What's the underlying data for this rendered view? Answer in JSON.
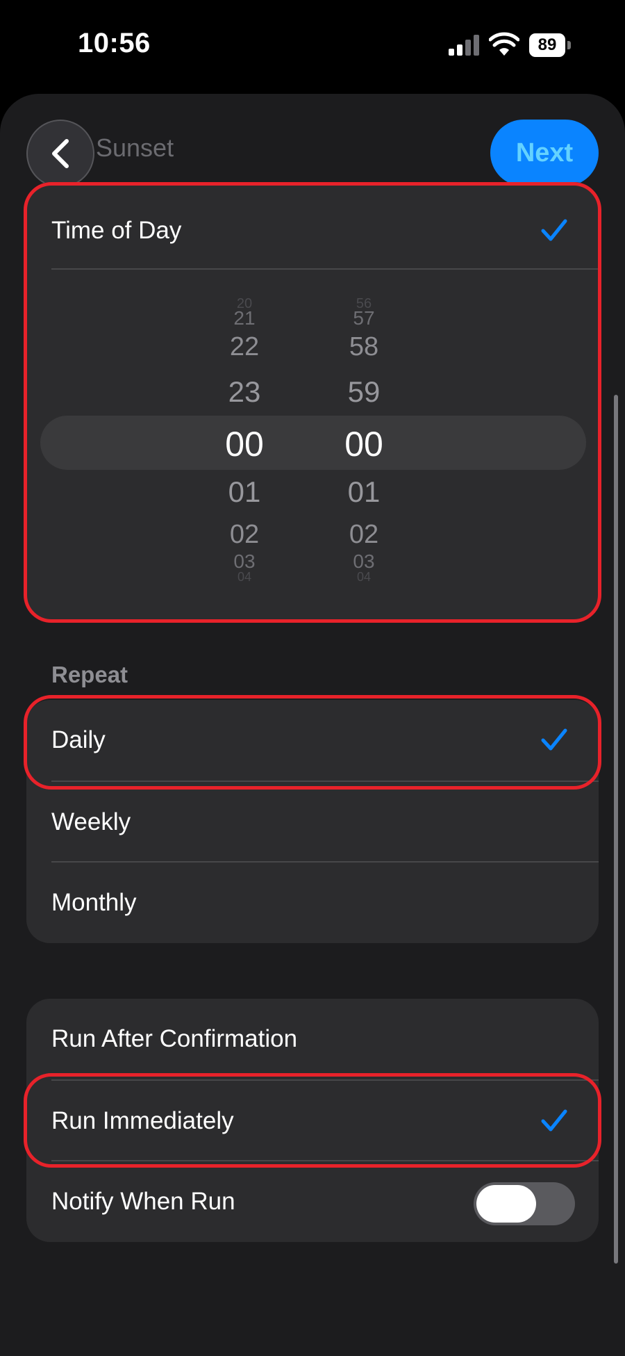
{
  "status_bar": {
    "time": "10:56",
    "battery": "89"
  },
  "nav": {
    "title": "Sunset",
    "next_label": "Next"
  },
  "time_of_day": {
    "label": "Time of Day",
    "hours": [
      "20",
      "21",
      "22",
      "23",
      "00",
      "01",
      "02",
      "03",
      "04"
    ],
    "minutes": [
      "56",
      "57",
      "58",
      "59",
      "00",
      "01",
      "02",
      "03",
      "04"
    ],
    "selected_hour": "00",
    "selected_minute": "00"
  },
  "repeat": {
    "header": "Repeat",
    "options": [
      {
        "label": "Daily",
        "selected": true
      },
      {
        "label": "Weekly",
        "selected": false
      },
      {
        "label": "Monthly",
        "selected": false
      }
    ]
  },
  "run": {
    "options": [
      {
        "label": "Run After Confirmation",
        "selected": false
      },
      {
        "label": "Run Immediately",
        "selected": true
      }
    ],
    "notify_label": "Notify When Run",
    "notify_on": false
  },
  "colors": {
    "accent": "#0a84ff",
    "highlight": "#e8222a",
    "card": "#2c2c2e",
    "sheet": "#1c1c1e"
  },
  "icons": {
    "back": "chevron-left-icon",
    "check": "checkmark-icon"
  }
}
